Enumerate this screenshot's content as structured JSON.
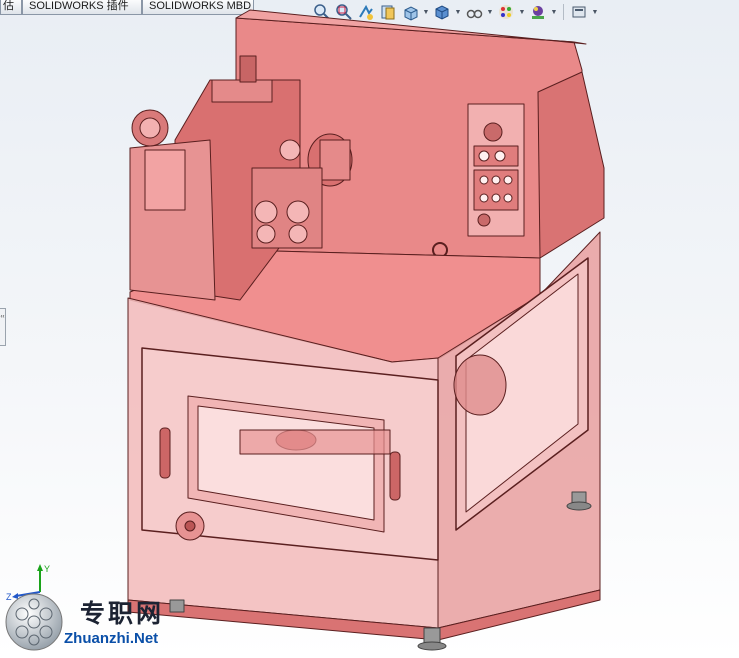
{
  "tabs": [
    "估",
    "SOLIDWORKS 插件",
    "SOLIDWORKS MBD"
  ],
  "heads_up_toolbar": [
    "zoom-to-fit-icon",
    "zoom-to-area-icon",
    "previous-view-icon",
    "section-view-icon",
    "view-orientation-icon",
    "display-style-icon",
    "hide-show-items-icon",
    "edit-appearance-icon",
    "apply-scene-icon",
    "view-settings-icon"
  ],
  "sidebar_toggle_glyphs": "‹‹",
  "watermark": {
    "cn": "专职网",
    "en": "Zhuanzhi.Net"
  },
  "triad": {
    "y": "Y",
    "z": "Z"
  },
  "colors": {
    "part": "#e87f7f",
    "part_dark": "#a84d4d",
    "glass": "#f3bcbc",
    "background_top": "#e9eef4"
  }
}
